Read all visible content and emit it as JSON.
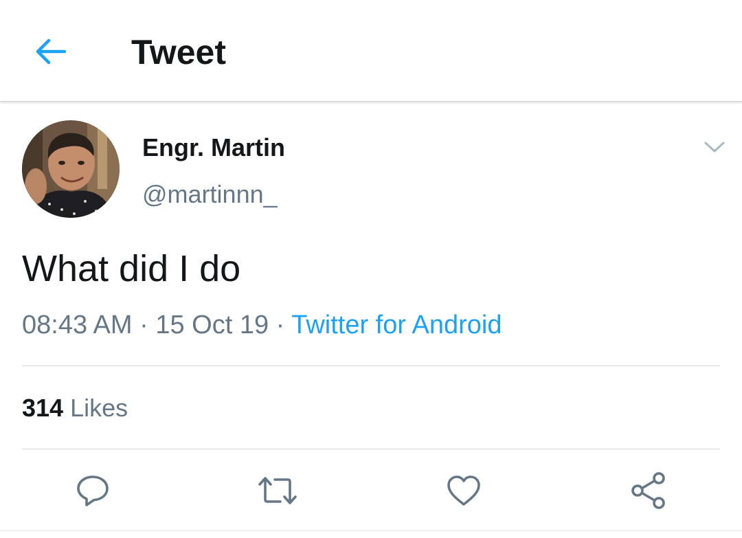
{
  "header": {
    "title": "Tweet",
    "back_icon": "arrow-left-icon"
  },
  "tweet": {
    "author": {
      "display_name": "Engr. Martin",
      "handle": "@martinnn_"
    },
    "text": "What did I do",
    "time": "08:43 AM",
    "separator": " · ",
    "date": "15 Oct 19",
    "source": "Twitter for Android",
    "likes": {
      "count": "314",
      "label": "Likes"
    },
    "actions": [
      "reply-icon",
      "retweet-icon",
      "like-icon",
      "share-icon"
    ]
  },
  "colors": {
    "accent": "#1da1f2",
    "text_primary": "#14171a",
    "text_secondary": "#657786",
    "icon_gray": "#657786",
    "divider": "#d3d8dc"
  }
}
